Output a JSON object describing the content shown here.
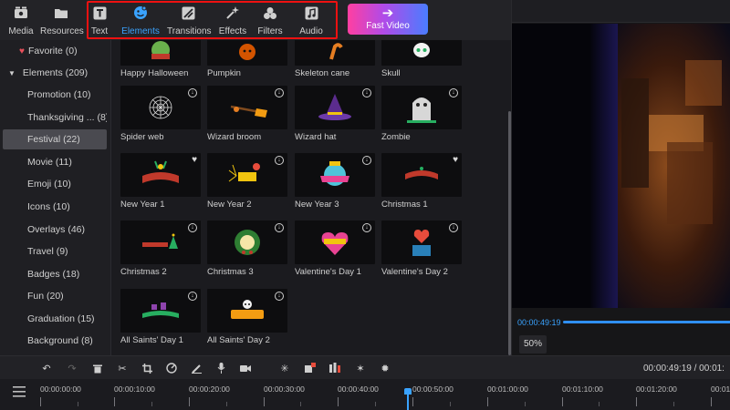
{
  "toolbar": {
    "tools": [
      {
        "label": "Media",
        "icon": "film-icon"
      },
      {
        "label": "Resources",
        "icon": "folder-icon"
      },
      {
        "label": "Text",
        "icon": "text-icon"
      },
      {
        "label": "Elements",
        "icon": "elements-icon"
      },
      {
        "label": "Transitions",
        "icon": "transitions-icon"
      },
      {
        "label": "Effects",
        "icon": "effects-icon"
      },
      {
        "label": "Filters",
        "icon": "filters-icon"
      },
      {
        "label": "Audio",
        "icon": "music-icon"
      }
    ],
    "active_tool": "Elements",
    "fast_video_label": "Fast Video"
  },
  "sidebar": {
    "items": [
      {
        "label": "Favorite (0)"
      },
      {
        "label": "Elements (209)"
      },
      {
        "label": "Promotion (10)"
      },
      {
        "label": "Thanksgiving ... (8)"
      },
      {
        "label": "Festival (22)"
      },
      {
        "label": "Movie (11)"
      },
      {
        "label": "Emoji (10)"
      },
      {
        "label": "Icons (10)"
      },
      {
        "label": "Overlays (46)"
      },
      {
        "label": "Travel (9)"
      },
      {
        "label": "Badges (18)"
      },
      {
        "label": "Fun (20)"
      },
      {
        "label": "Graduation (15)"
      },
      {
        "label": "Background (8)"
      }
    ],
    "selected": "Festival (22)"
  },
  "grid": {
    "items": [
      {
        "caption": "Happy Halloween"
      },
      {
        "caption": "Pumpkin"
      },
      {
        "caption": "Skeleton cane"
      },
      {
        "caption": "Skull"
      },
      {
        "caption": "Spider web",
        "badge": "download"
      },
      {
        "caption": "Wizard broom",
        "badge": "download"
      },
      {
        "caption": "Wizard hat",
        "badge": "download"
      },
      {
        "caption": "Zombie",
        "badge": "download"
      },
      {
        "caption": "New Year 1",
        "badge": "favorite"
      },
      {
        "caption": "New Year 2",
        "badge": "download"
      },
      {
        "caption": "New Year 3",
        "badge": "download"
      },
      {
        "caption": "Christmas 1",
        "badge": "favorite"
      },
      {
        "caption": "Christmas 2",
        "badge": "download"
      },
      {
        "caption": "Christmas 3",
        "badge": "download"
      },
      {
        "caption": "Valentine's Day 1",
        "badge": "download"
      },
      {
        "caption": "Valentine's Day 2",
        "badge": "download"
      },
      {
        "caption": "All Saints' Day 1",
        "badge": "download"
      },
      {
        "caption": "All Saints' Day 2",
        "badge": "download"
      }
    ]
  },
  "preview": {
    "time": "00:00:49:19",
    "zoom": "50%"
  },
  "timeline": {
    "time_display": "00:00:49:19 / 00:01:",
    "ruler_labels": [
      "00:00:00:00",
      "00:00:10:00",
      "00:00:20:00",
      "00:00:30:00",
      "00:00:40:00",
      "00:00:50:00",
      "00:01:00:00",
      "00:01:10:00",
      "00:01:20:00",
      "00:01:30:00"
    ],
    "controls": [
      "undo-icon",
      "redo-icon",
      "delete-icon",
      "cut-icon",
      "crop-icon",
      "speed-icon",
      "pen-icon",
      "mic-icon",
      "camera-icon",
      "freeze-icon",
      "detach-icon",
      "split-icon",
      "magic-icon",
      "mask-icon"
    ]
  },
  "colors": {
    "accent": "#3aa3ff",
    "highlight_box": "#e11111",
    "background": "#1b1b1f"
  }
}
